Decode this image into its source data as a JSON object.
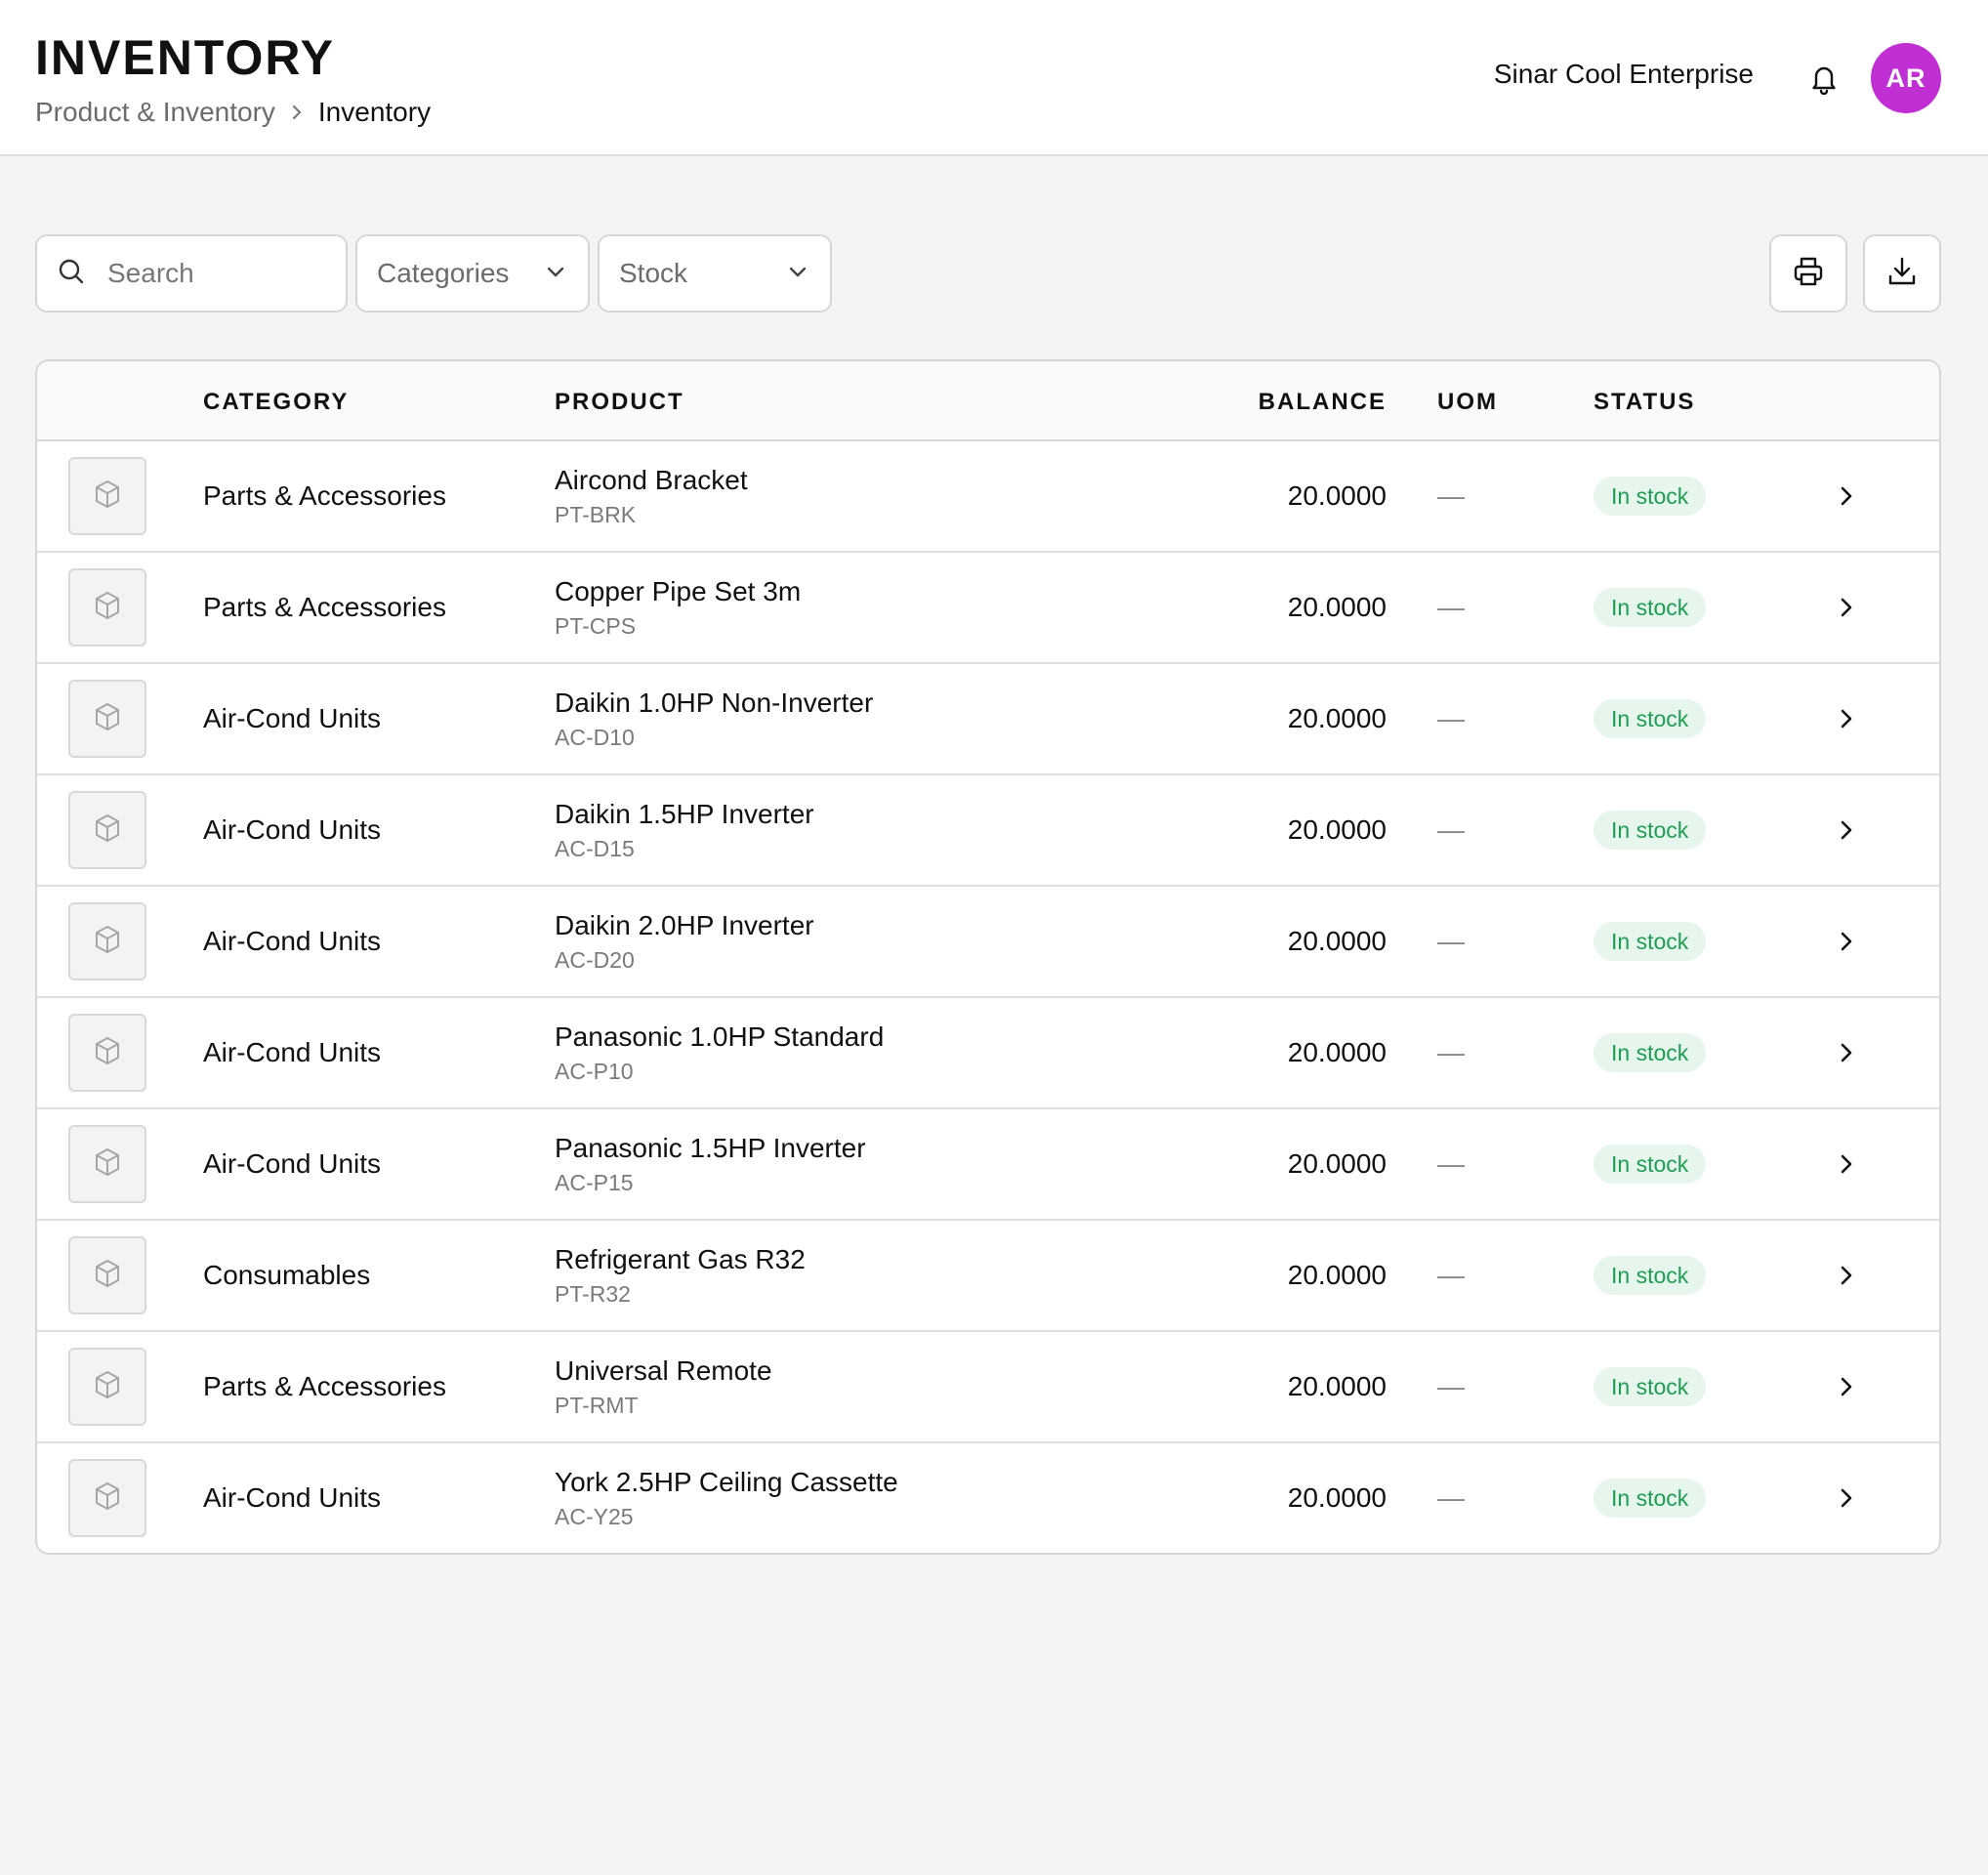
{
  "header": {
    "title": "INVENTORY",
    "breadcrumb": {
      "parent": "Product & Inventory",
      "current": "Inventory"
    },
    "company": "Sinar Cool Enterprise",
    "avatar_initials": "AR",
    "avatar_color": "#c02fd3"
  },
  "toolbar": {
    "search_placeholder": "Search",
    "categories_label": "Categories",
    "stock_label": "Stock",
    "icons": {
      "print": "printer-icon",
      "download": "download-icon",
      "search": "search-icon"
    }
  },
  "table": {
    "columns": {
      "category": "CATEGORY",
      "product": "PRODUCT",
      "balance": "BALANCE",
      "uom": "UOM",
      "status": "STATUS"
    },
    "status_color": "#1f9d55",
    "rows": [
      {
        "category": "Parts & Accessories",
        "name": "Aircond Bracket",
        "code": "PT-BRK",
        "balance": "20.0000",
        "uom": "—",
        "status": "In stock"
      },
      {
        "category": "Parts & Accessories",
        "name": "Copper Pipe Set 3m",
        "code": "PT-CPS",
        "balance": "20.0000",
        "uom": "—",
        "status": "In stock"
      },
      {
        "category": "Air-Cond Units",
        "name": "Daikin 1.0HP Non-Inverter",
        "code": "AC-D10",
        "balance": "20.0000",
        "uom": "—",
        "status": "In stock"
      },
      {
        "category": "Air-Cond Units",
        "name": "Daikin 1.5HP Inverter",
        "code": "AC-D15",
        "balance": "20.0000",
        "uom": "—",
        "status": "In stock"
      },
      {
        "category": "Air-Cond Units",
        "name": "Daikin 2.0HP Inverter",
        "code": "AC-D20",
        "balance": "20.0000",
        "uom": "—",
        "status": "In stock"
      },
      {
        "category": "Air-Cond Units",
        "name": "Panasonic 1.0HP Standard",
        "code": "AC-P10",
        "balance": "20.0000",
        "uom": "—",
        "status": "In stock"
      },
      {
        "category": "Air-Cond Units",
        "name": "Panasonic 1.5HP Inverter",
        "code": "AC-P15",
        "balance": "20.0000",
        "uom": "—",
        "status": "In stock"
      },
      {
        "category": "Consumables",
        "name": "Refrigerant Gas R32",
        "code": "PT-R32",
        "balance": "20.0000",
        "uom": "—",
        "status": "In stock"
      },
      {
        "category": "Parts & Accessories",
        "name": "Universal Remote",
        "code": "PT-RMT",
        "balance": "20.0000",
        "uom": "—",
        "status": "In stock"
      },
      {
        "category": "Air-Cond Units",
        "name": "York 2.5HP Ceiling Cassette",
        "code": "AC-Y25",
        "balance": "20.0000",
        "uom": "—",
        "status": "In stock"
      }
    ]
  }
}
